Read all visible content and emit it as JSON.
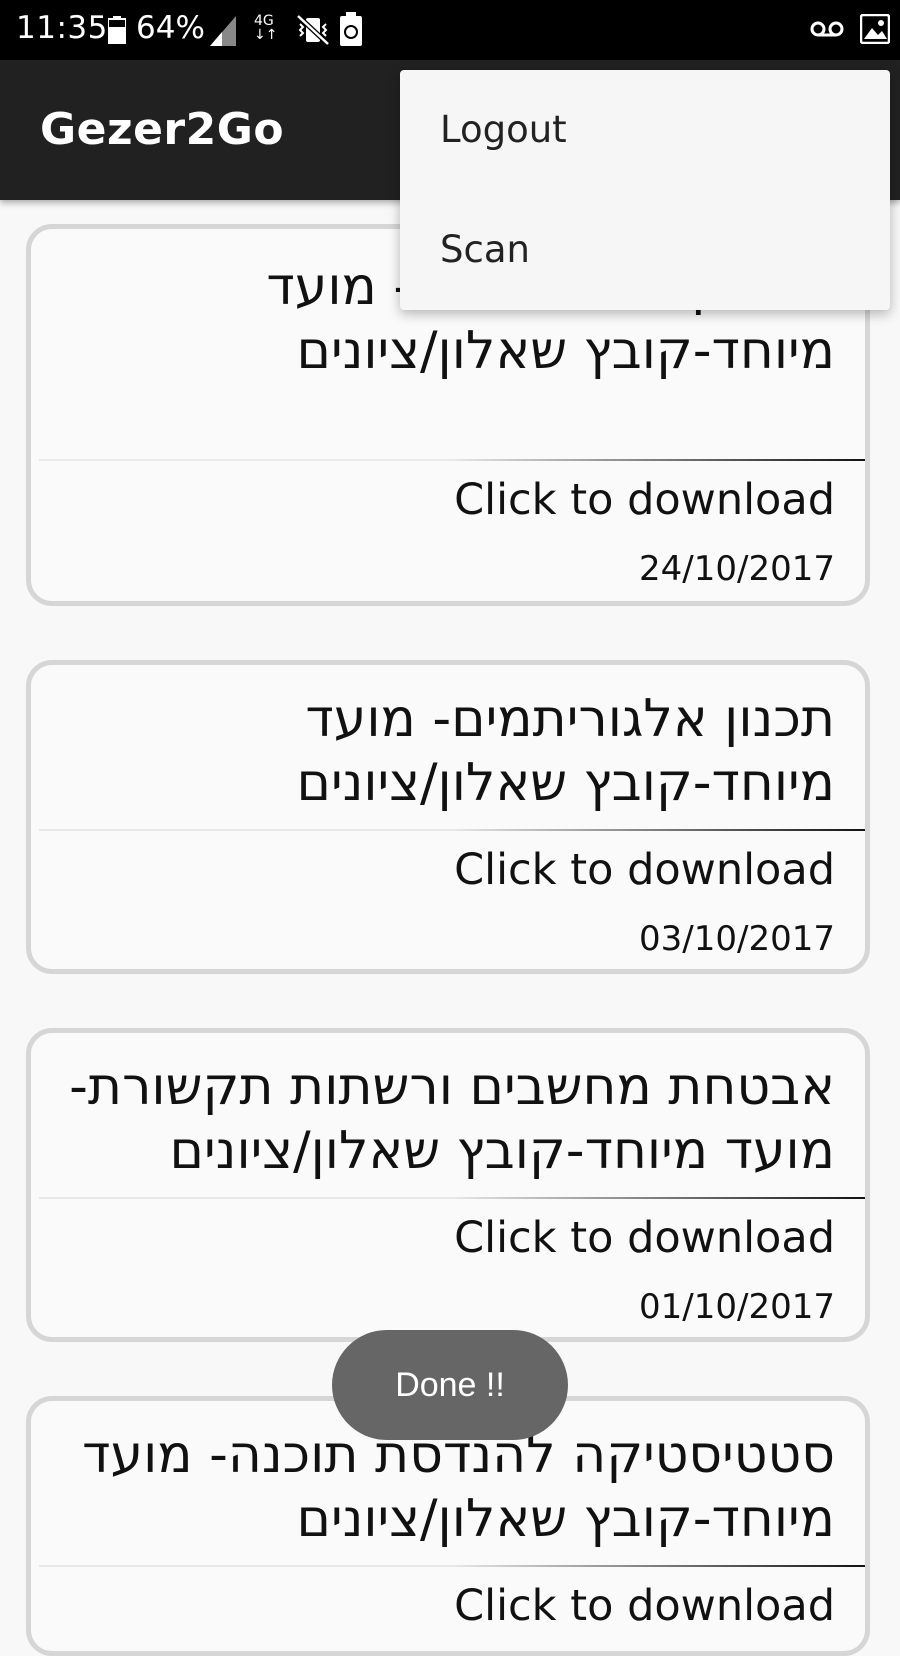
{
  "status_bar": {
    "time": "11:35",
    "battery": "64%",
    "icons": [
      "battery-icon",
      "signal-icon",
      "network-4g-icon",
      "vibrate-mute-icon",
      "recycle-icon",
      "voicemail-icon",
      "image-icon"
    ],
    "network": "4G"
  },
  "toolbar": {
    "title": "Gezer2Go"
  },
  "menu": {
    "items": [
      {
        "label": "Logout"
      },
      {
        "label": "Scan"
      }
    ]
  },
  "cards": [
    {
      "title": "ממשקי אדם מחשב- מועד מיוחד-קובץ שאלון/ציונים",
      "link": "Click to download",
      "date": "24/10/2017"
    },
    {
      "title": "תכנון אלגוריתמים- מועד מיוחד-קובץ שאלון/ציונים",
      "link": "Click to download",
      "date": "03/10/2017"
    },
    {
      "title": "אבטחת מחשבים ורשתות תקשורת- מועד מיוחד-קובץ שאלון/ציונים",
      "link": "Click to download",
      "date": "01/10/2017"
    },
    {
      "title": "סטטיסטיקה להנדסת תוכנה- מועד מיוחד-קובץ שאלון/ציונים",
      "link": "Click to download",
      "date": ""
    }
  ],
  "toast": {
    "text": "Done !!"
  },
  "colors": {
    "toolbar": "#212121",
    "status_bar": "#000000",
    "background": "#f8f8f8",
    "card_border": "#d6d6d6",
    "toast": "#666666"
  }
}
